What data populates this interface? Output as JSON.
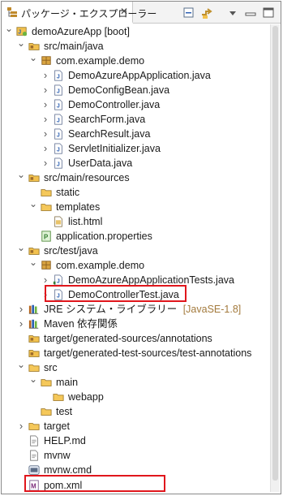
{
  "view": {
    "title": "パッケージ・エクスプローラー",
    "close_glyph": "✕",
    "toolbar": [
      "collapse-all-icon",
      "link-with-editor-icon",
      "view-menu-icon",
      "minimize-icon",
      "maximize-icon"
    ]
  },
  "tree": [
    {
      "label": "demoAzureApp [boot]",
      "icon": "project-icon",
      "expanded": true
    },
    {
      "label": "src/main/java",
      "icon": "source-folder-icon",
      "expanded": true
    },
    {
      "label": "com.example.demo",
      "icon": "package-icon",
      "expanded": true
    },
    {
      "label": "DemoAzureAppApplication.java",
      "icon": "java-file-icon",
      "expanded": false
    },
    {
      "label": "DemoConfigBean.java",
      "icon": "java-file-icon",
      "expanded": false
    },
    {
      "label": "DemoController.java",
      "icon": "java-file-icon",
      "expanded": false
    },
    {
      "label": "SearchForm.java",
      "icon": "java-file-icon",
      "expanded": false
    },
    {
      "label": "SearchResult.java",
      "icon": "java-file-icon",
      "expanded": false
    },
    {
      "label": "ServletInitializer.java",
      "icon": "java-file-icon",
      "expanded": false
    },
    {
      "label": "UserData.java",
      "icon": "java-file-icon",
      "expanded": false
    },
    {
      "label": "src/main/resources",
      "icon": "source-folder-icon",
      "expanded": true
    },
    {
      "label": "static",
      "icon": "folder-icon",
      "expanded": null
    },
    {
      "label": "templates",
      "icon": "folder-icon",
      "expanded": true
    },
    {
      "label": "list.html",
      "icon": "html-file-icon",
      "expanded": null
    },
    {
      "label": "application.properties",
      "icon": "properties-file-icon",
      "expanded": null
    },
    {
      "label": "src/test/java",
      "icon": "source-folder-icon",
      "expanded": true
    },
    {
      "label": "com.example.demo",
      "icon": "package-icon",
      "expanded": true
    },
    {
      "label": "DemoAzureAppApplicationTests.java",
      "icon": "java-test-file-icon",
      "expanded": false
    },
    {
      "label": "DemoControllerTest.java",
      "icon": "java-file-icon",
      "expanded": false
    },
    {
      "label": "JRE システム・ライブラリー",
      "suffix": "[JavaSE-1.8]",
      "icon": "library-icon",
      "expanded": false
    },
    {
      "label": "Maven 依存関係",
      "icon": "library-icon",
      "expanded": false
    },
    {
      "label": "target/generated-sources/annotations",
      "icon": "source-folder-icon",
      "expanded": null
    },
    {
      "label": "target/generated-test-sources/test-annotations",
      "icon": "source-folder-icon",
      "expanded": null
    },
    {
      "label": "src",
      "icon": "folder-icon",
      "expanded": true
    },
    {
      "label": "main",
      "icon": "folder-icon",
      "expanded": true
    },
    {
      "label": "webapp",
      "icon": "folder-icon",
      "expanded": null
    },
    {
      "label": "test",
      "icon": "folder-icon",
      "expanded": null
    },
    {
      "label": "target",
      "icon": "folder-icon",
      "expanded": false
    },
    {
      "label": "HELP.md",
      "icon": "text-file-icon",
      "expanded": null
    },
    {
      "label": "mvnw",
      "icon": "text-file-icon",
      "expanded": null
    },
    {
      "label": "mvnw.cmd",
      "icon": "cmd-file-icon",
      "expanded": null
    },
    {
      "label": "pom.xml",
      "icon": "maven-pom-icon",
      "expanded": null
    }
  ],
  "highlights": [
    "DemoControllerTest.java",
    "pom.xml"
  ]
}
